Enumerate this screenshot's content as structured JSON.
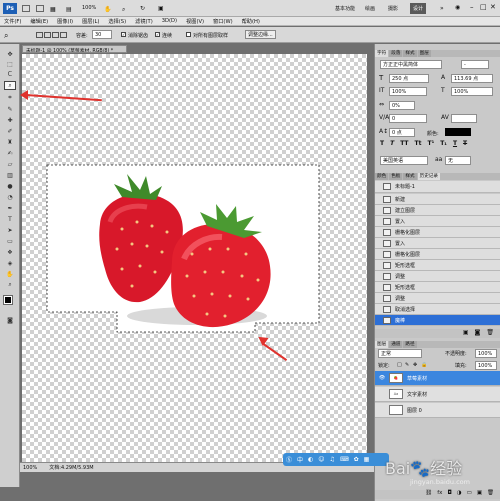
{
  "app": {
    "zoom_display": "100%",
    "workspaces": [
      "基本功能",
      "绘画",
      "摄影",
      "设计"
    ],
    "active_workspace": "设计"
  },
  "menu": [
    "文件(F)",
    "编辑(E)",
    "图像(I)",
    "图层(L)",
    "选择(S)",
    "滤镜(T)",
    "3D(D)",
    "视图(V)",
    "窗口(W)",
    "帮助(H)"
  ],
  "options_bar": {
    "tolerance_label": "容差:",
    "tolerance_value": "30",
    "antialias_label": "消除锯齿",
    "contiguous_label": "连续",
    "all_layers_label": "对所有图层取样",
    "refine_edge_label": "调整边缘..."
  },
  "document": {
    "tab_title": "未标题-1 @ 100% (草莓素材, RGB/8) *",
    "status_zoom": "100%",
    "status_doc": "文档:4.29M/5.93M"
  },
  "character_panel": {
    "tabs": [
      "字符",
      "段落",
      "样式",
      "图层"
    ],
    "font_family": "方正正中黑简体",
    "font_style": "-",
    "font_size": "250 点",
    "leading": "113.69 点",
    "vertical_scale": "100%",
    "horizontal_scale": "100%",
    "tracking_pct": "0%",
    "kerning": "0",
    "baseline": "0 点",
    "color_label": "颜色:",
    "color_value": "#000000",
    "language": "美国英语",
    "antialias_abbr": "aa",
    "antialias_value": "无"
  },
  "history_panel": {
    "tabs": [
      "颜色",
      "色板",
      "样式",
      "历史记录"
    ],
    "snapshot": "未标题-1",
    "items": [
      "新建",
      "建立图层",
      "置入",
      "栅格化图层",
      "置入",
      "栅格化图层",
      "矩形选框",
      "调整",
      "矩形选框",
      "调整",
      "取消选择",
      "魔棒"
    ]
  },
  "layers_panel": {
    "tabs": [
      "图层",
      "通道",
      "路径"
    ],
    "blend_mode": "正常",
    "opacity_label": "不透明度:",
    "opacity_value": "100%",
    "lock_label": "锁定:",
    "fill_label": "填充:",
    "fill_value": "100%",
    "layers": [
      {
        "name": "草莓素材",
        "selected": true
      },
      {
        "name": "文字素材",
        "selected": false
      },
      {
        "name": "图层 0",
        "selected": false
      }
    ]
  },
  "watermark": {
    "text": "经验",
    "sub": "jingyan.baidu.com"
  },
  "colors": {
    "accent": "#2d6fd6",
    "arrow": "#e0322d"
  }
}
